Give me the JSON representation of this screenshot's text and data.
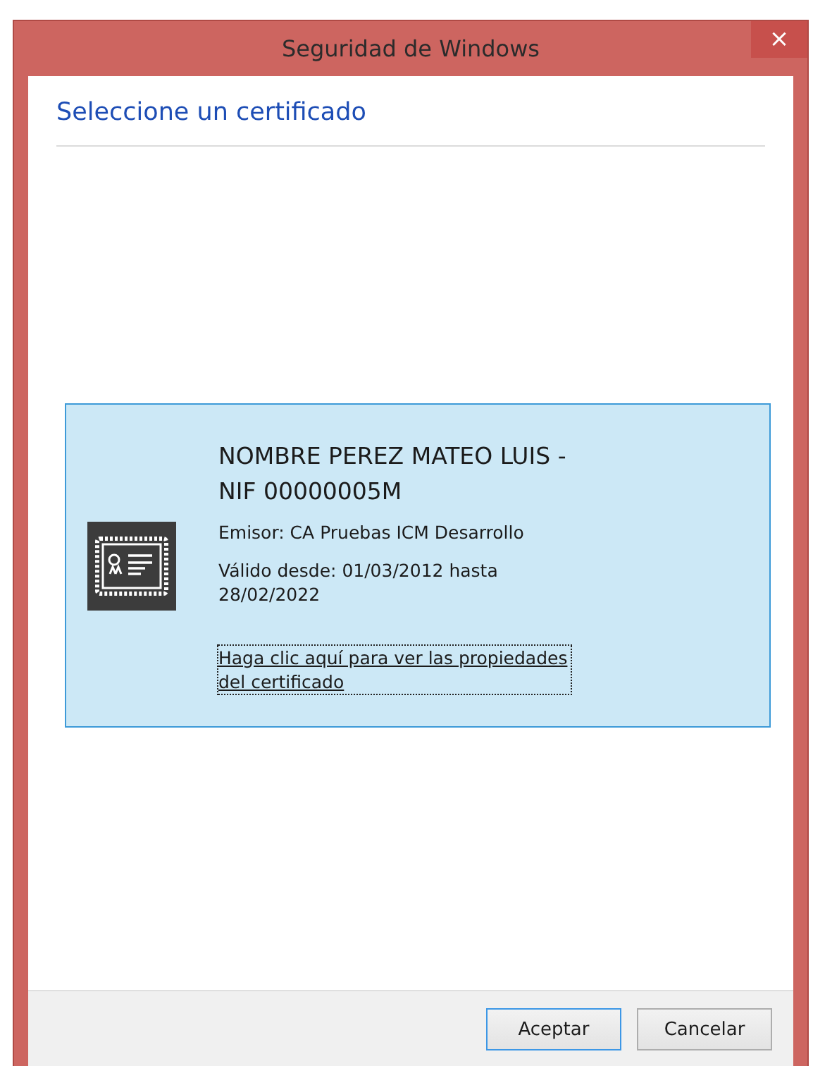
{
  "window": {
    "title": "Seguridad de Windows",
    "close": "×"
  },
  "heading": "Seleccione un certificado",
  "certificates": [
    {
      "name": "NOMBRE PEREZ MATEO LUIS - NIF 00000005M",
      "issuer": "Emisor: CA Pruebas ICM Desarrollo",
      "validity": "Válido desde: 01/03/2012 hasta 28/02/2022",
      "link": "Haga clic aquí para ver las propiedades del certificado",
      "selected": true
    }
  ],
  "buttons": [
    {
      "label": "Aceptar",
      "default": true
    },
    {
      "label": "Cancelar",
      "default": false
    }
  ]
}
